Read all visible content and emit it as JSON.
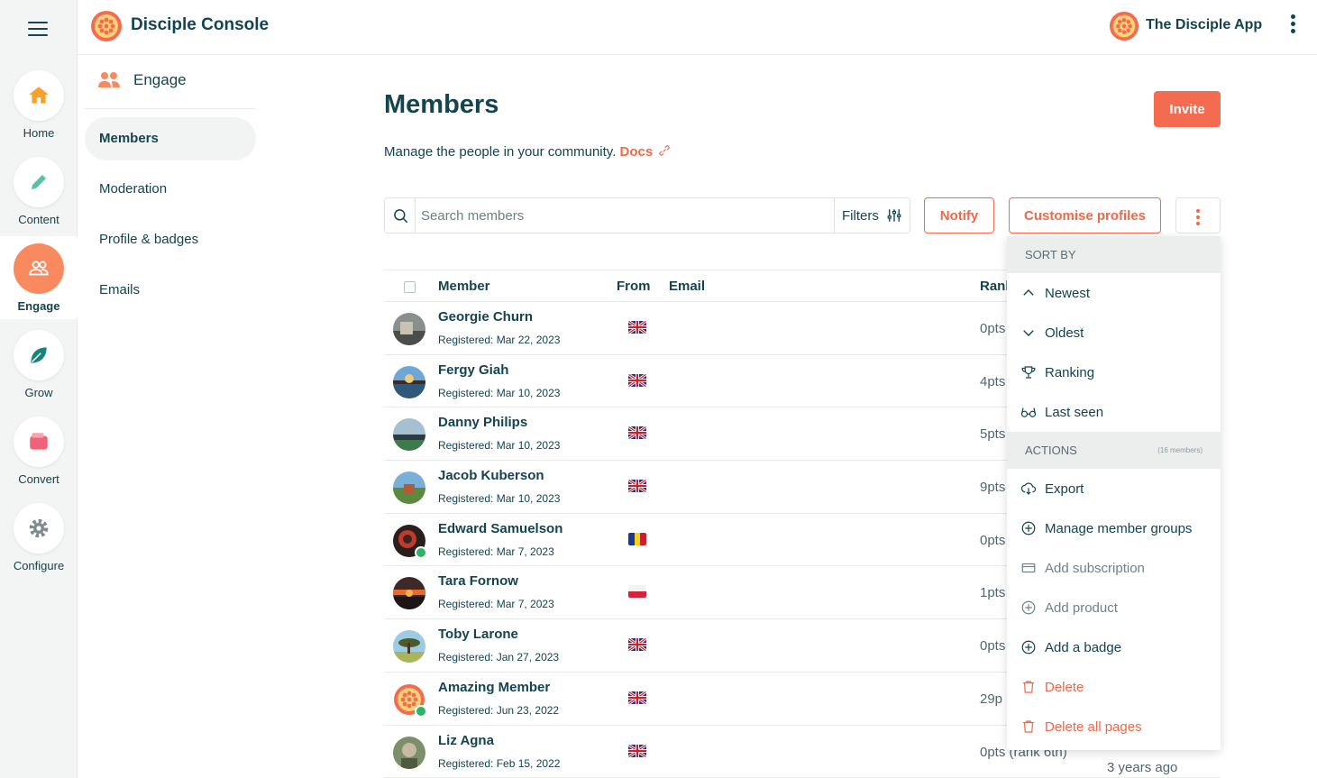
{
  "app": {
    "title": "Disciple Console",
    "community_name": "The Disciple App"
  },
  "rail": {
    "items": [
      {
        "label": "Home"
      },
      {
        "label": "Content"
      },
      {
        "label": "Engage"
      },
      {
        "label": "Grow"
      },
      {
        "label": "Convert"
      },
      {
        "label": "Configure"
      }
    ],
    "active": "Engage"
  },
  "subnav": {
    "heading": "Engage",
    "items": [
      {
        "label": "Members"
      },
      {
        "label": "Moderation"
      },
      {
        "label": "Profile & badges"
      },
      {
        "label": "Emails"
      }
    ]
  },
  "main": {
    "title": "Members",
    "description": "Manage the people in your community.",
    "docs_label": "Docs",
    "invite_label": "Invite",
    "search_placeholder": "Search members",
    "filters_label": "Filters",
    "notify_label": "Notify",
    "customise_label": "Customise profiles"
  },
  "table": {
    "columns": {
      "member": "Member",
      "from": "From",
      "email": "Email",
      "rank": "Ranl"
    },
    "rows": [
      {
        "name": "Georgie Churn",
        "registered": "Registered: Mar 22, 2023",
        "country": "uk",
        "points": "0pts",
        "verified": false
      },
      {
        "name": "Fergy Giah",
        "registered": "Registered: Mar 10, 2023",
        "country": "uk",
        "points": "4pts",
        "verified": false
      },
      {
        "name": "Danny Philips",
        "registered": "Registered: Mar 10, 2023",
        "country": "uk",
        "points": "5pts",
        "verified": false
      },
      {
        "name": "Jacob Kuberson",
        "registered": "Registered: Mar 10, 2023",
        "country": "uk",
        "points": "9pts",
        "verified": false
      },
      {
        "name": "Edward Samuelson",
        "registered": "Registered: Mar 7, 2023",
        "country": "ro",
        "points": "0pts",
        "verified": true
      },
      {
        "name": "Tara Fornow",
        "registered": "Registered: Mar 7, 2023",
        "country": "pl",
        "points": "1pts",
        "verified": false
      },
      {
        "name": "Toby Larone",
        "registered": "Registered: Jan 27, 2023",
        "country": "uk",
        "points": "0pts",
        "verified": false
      },
      {
        "name": "Amazing Member",
        "registered": "Registered: Jun 23, 2022",
        "country": "uk",
        "points": "29p",
        "verified": true
      },
      {
        "name": "Liz Agna",
        "registered": "Registered: Feb 15, 2022",
        "country": "uk",
        "points": "0pts (rank 6th)",
        "verified": false,
        "last_seen": "3 years ago"
      }
    ]
  },
  "dropdown": {
    "sort_heading": "SORT BY",
    "sort_items": [
      {
        "label": "Newest",
        "icon": "chevron-up-icon"
      },
      {
        "label": "Oldest",
        "icon": "chevron-down-icon"
      },
      {
        "label": "Ranking",
        "icon": "trophy-icon"
      },
      {
        "label": "Last seen",
        "icon": "glasses-icon"
      }
    ],
    "actions_heading": "ACTIONS",
    "actions_count": "(16 members)",
    "action_items": [
      {
        "label": "Export",
        "icon": "cloud-download-icon"
      },
      {
        "label": "Manage member groups",
        "icon": "plus-circle-icon"
      },
      {
        "label": "Add subscription",
        "icon": "credit-card-icon"
      },
      {
        "label": "Add product",
        "icon": "plus-circle-icon"
      },
      {
        "label": "Add a badge",
        "icon": "plus-circle-icon"
      },
      {
        "label": "Delete",
        "icon": "trash-icon"
      },
      {
        "label": "Delete all pages",
        "icon": "trash-icon"
      }
    ]
  },
  "colors": {
    "accent": "#f46b4f",
    "text": "#13444f",
    "rail_bg": "#f3f4f4",
    "success": "#2ab463"
  }
}
